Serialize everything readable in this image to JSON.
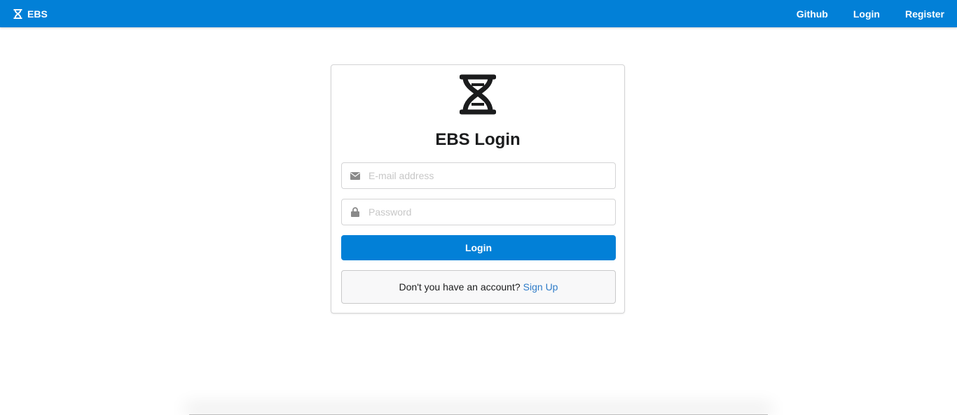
{
  "header": {
    "brand": "EBS",
    "nav": [
      "Github",
      "Login",
      "Register"
    ]
  },
  "login_card": {
    "title": "EBS Login",
    "email_placeholder": "E-mail address",
    "password_placeholder": "Password",
    "login_button": "Login",
    "signup_prompt": "Don't you have an account?",
    "signup_link": "Sign Up"
  },
  "icons": {
    "brand": "dna-icon",
    "logo": "dna-icon",
    "email": "envelope-icon",
    "password": "lock-icon"
  },
  "colors": {
    "primary": "#0280d7",
    "link": "#2f7cc8"
  }
}
